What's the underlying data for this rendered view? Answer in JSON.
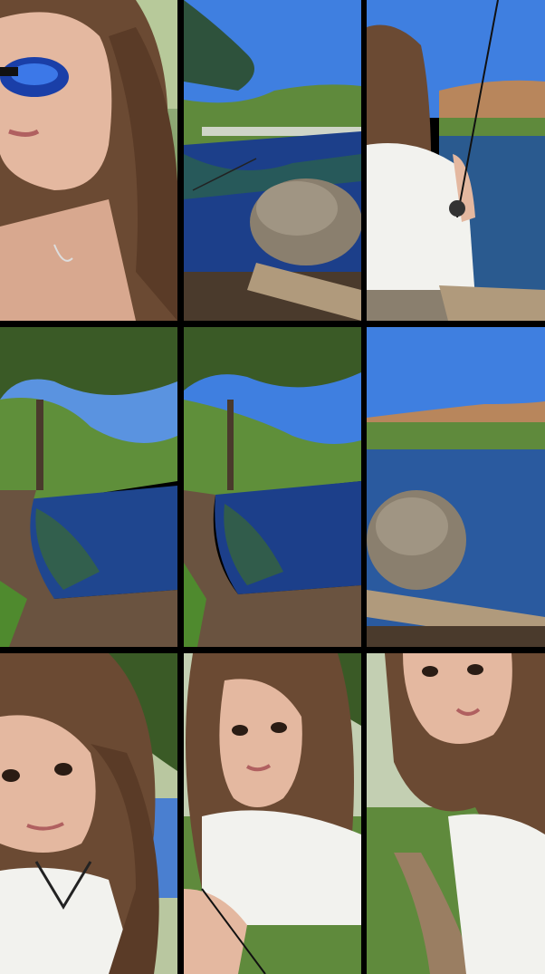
{
  "grid": {
    "rows": 3,
    "columns": 3,
    "frames": [
      {
        "scene": "selfie-blue-sunglasses"
      },
      {
        "scene": "pond-rock-fishing-line"
      },
      {
        "scene": "woman-holding-fishing-rod"
      },
      {
        "scene": "pond-under-tree"
      },
      {
        "scene": "pond-under-tree-wide"
      },
      {
        "scene": "pond-rock-log"
      },
      {
        "scene": "selfie-leaning-close"
      },
      {
        "scene": "selfie-holding-rod"
      },
      {
        "scene": "selfie-talking-path"
      }
    ]
  },
  "colors": {
    "separator": "#000000",
    "sky": "#3f7fe0",
    "water": "#1c3f8a",
    "foliage": "#4c7a2e",
    "hair": "#6b4a33",
    "skin": "#e4b8a0",
    "shirt": "#f2f2ee"
  }
}
